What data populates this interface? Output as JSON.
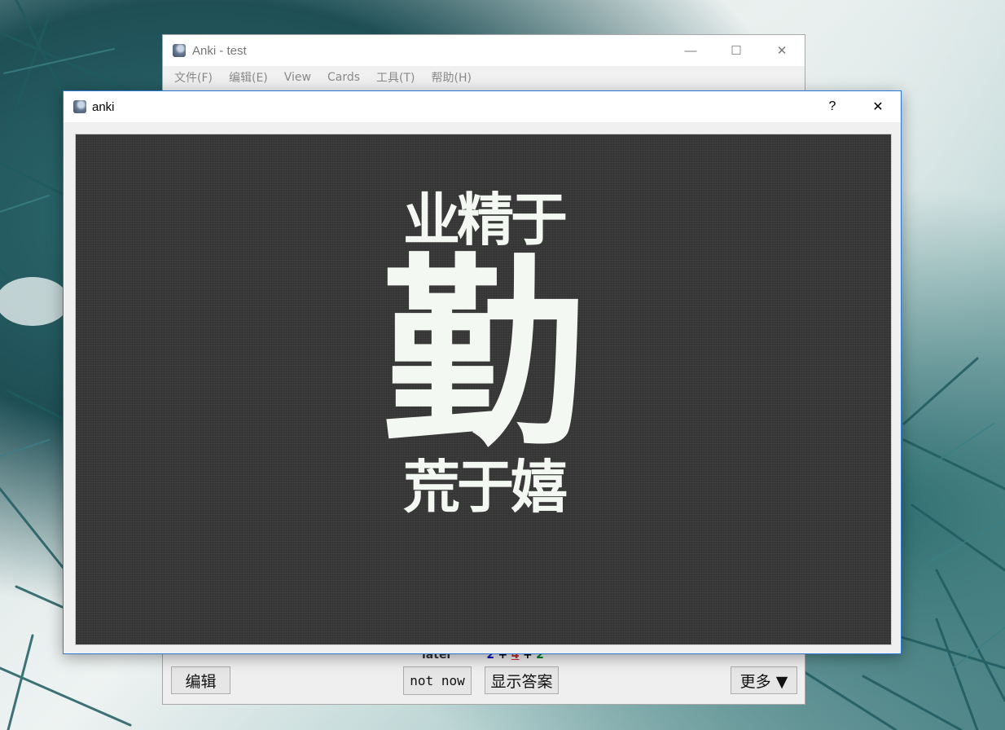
{
  "main_window": {
    "title": "Anki - test",
    "controls": {
      "minimize": "—",
      "maximize": "☐",
      "close": "✕"
    },
    "menu": [
      "文件(F)",
      "编辑(E)",
      "View",
      "Cards",
      "工具(T)",
      "帮助(H)"
    ],
    "stats": {
      "label": "later",
      "new": "2",
      "plus1": "+",
      "learning": "4",
      "plus2": "+",
      "review": "2"
    },
    "buttons": {
      "edit": "编辑",
      "not_now": "not now",
      "show_answer": "显示答案",
      "more": "更多 ▼"
    },
    "colors": {
      "new": "#1010c0",
      "learning": "#c43030",
      "review": "#00802b"
    }
  },
  "dialog": {
    "title": "anki",
    "controls": {
      "help": "?",
      "close": "✕"
    },
    "card": {
      "line1": "业精于",
      "big": "勤",
      "line3": "荒于嬉"
    }
  }
}
